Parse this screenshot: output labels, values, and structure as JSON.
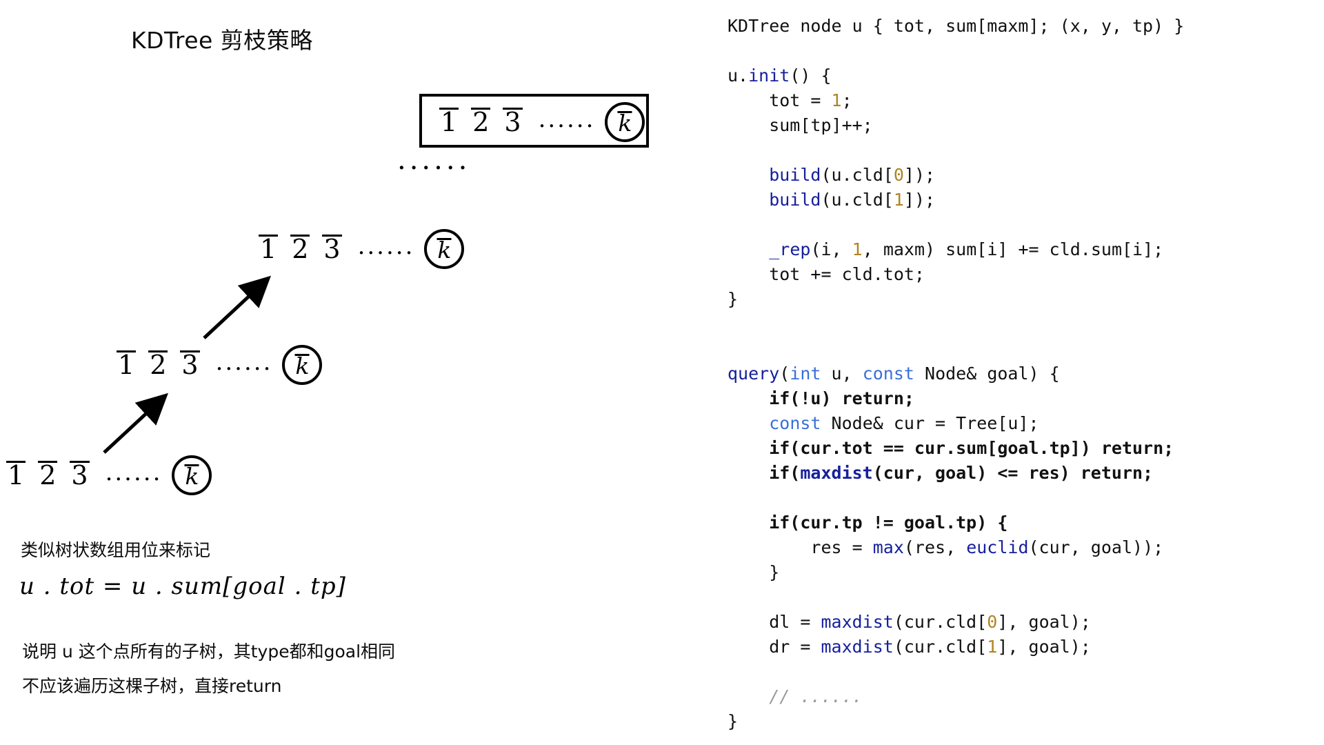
{
  "slide": {
    "title": "KDTree 剪枝策略"
  },
  "diagram": {
    "cells": [
      "1",
      "2",
      "3"
    ],
    "ellipsis": "......",
    "circle_label": "k",
    "vertical_ellipsis": "......",
    "rows": [
      {
        "name": "root-array-row",
        "boxed": true
      },
      {
        "name": "array-row-2",
        "boxed": false
      },
      {
        "name": "array-row-3",
        "boxed": false
      },
      {
        "name": "array-row-4",
        "boxed": false
      }
    ]
  },
  "notes": {
    "line1": "类似树状数组用位来标记",
    "formula": "u . tot = u . sum[goal . tp]",
    "line2": "说明 u 这个点所有的子树，其type都和goal相同",
    "line3": "不应该遍历这棵子树，直接return"
  },
  "code": {
    "language": "cpp",
    "colors": {
      "keyword": "#3a6fd8",
      "function": "#16209c",
      "number": "#b08423",
      "comment": "#9a9a9a",
      "text": "#111111"
    },
    "lines": [
      "KDTree node u { tot, sum[maxm]; (x, y, tp) }",
      "",
      "u.init() {",
      "    tot = 1;",
      "    sum[tp]++;",
      "",
      "    build(u.cld[0]);",
      "    build(u.cld[1]);",
      "",
      "    _rep(i, 1, maxm) sum[i] += cld.sum[i];",
      "    tot += cld.tot;",
      "}",
      "",
      "",
      "query(int u, const Node& goal) {",
      "    if(!u) return;",
      "    const Node& cur = Tree[u];",
      "    if(cur.tot == cur.sum[goal.tp]) return;",
      "    if(maxdist(cur, goal) <= res) return;",
      "",
      "    if(cur.tp != goal.tp) {",
      "        res = max(res, euclid(cur, goal));",
      "    }",
      "",
      "    dl = maxdist(cur.cld[0], goal);",
      "    dr = maxdist(cur.cld[1], goal);",
      "",
      "    // ......",
      "}"
    ]
  }
}
